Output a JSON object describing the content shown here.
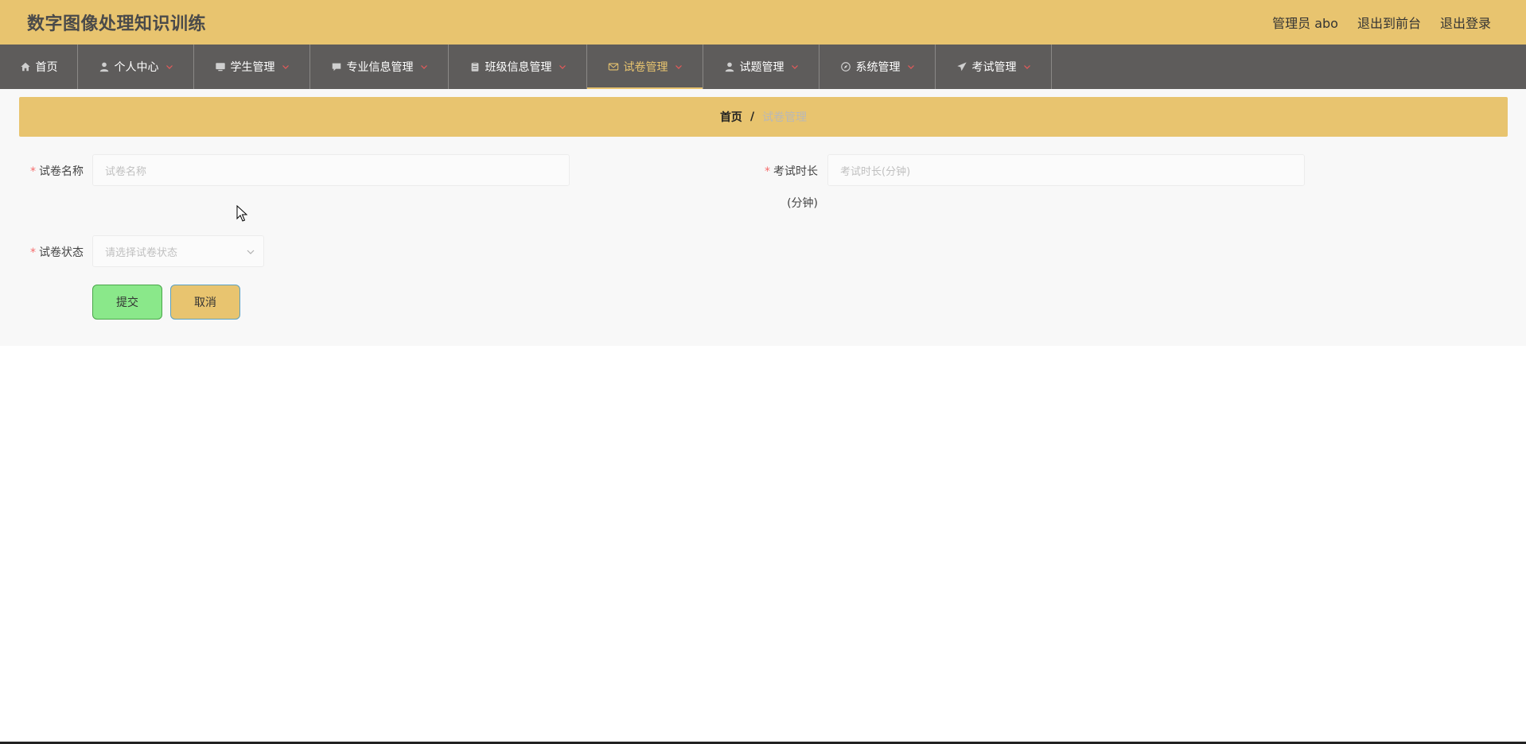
{
  "app": {
    "title": "数字图像处理知识训练"
  },
  "header": {
    "user_label": "管理员 abo",
    "front_link": "退出到前台",
    "logout_link": "退出登录"
  },
  "nav": {
    "items": [
      {
        "label": "首页",
        "icon": "home-icon",
        "has_dropdown": false
      },
      {
        "label": "个人中心",
        "icon": "user-icon",
        "has_dropdown": true
      },
      {
        "label": "学生管理",
        "icon": "monitor-icon",
        "has_dropdown": true
      },
      {
        "label": "专业信息管理",
        "icon": "chat-icon",
        "has_dropdown": true
      },
      {
        "label": "班级信息管理",
        "icon": "clipboard-icon",
        "has_dropdown": true
      },
      {
        "label": "试卷管理",
        "icon": "mail-icon",
        "has_dropdown": true,
        "active": true
      },
      {
        "label": "试题管理",
        "icon": "user-icon",
        "has_dropdown": true
      },
      {
        "label": "系统管理",
        "icon": "compass-icon",
        "has_dropdown": true
      },
      {
        "label": "考试管理",
        "icon": "send-icon",
        "has_dropdown": true
      }
    ]
  },
  "breadcrumb": {
    "home": "首页",
    "separator": "/",
    "current": "试卷管理"
  },
  "form": {
    "paper_name_label": "试卷名称",
    "paper_name_placeholder": "试卷名称",
    "duration_label": "考试时长",
    "duration_label_line2": "(分钟)",
    "duration_placeholder": "考试时长(分钟)",
    "status_label": "试卷状态",
    "status_placeholder": "请选择试卷状态",
    "required_mark": "*",
    "submit_label": "提交",
    "cancel_label": "取消"
  },
  "colors": {
    "header_bg": "#e8c46f",
    "nav_bg": "#5e5c5b",
    "accent": "#e8c46f",
    "submit_bg": "#8ae88a",
    "required": "#f56c6c"
  }
}
